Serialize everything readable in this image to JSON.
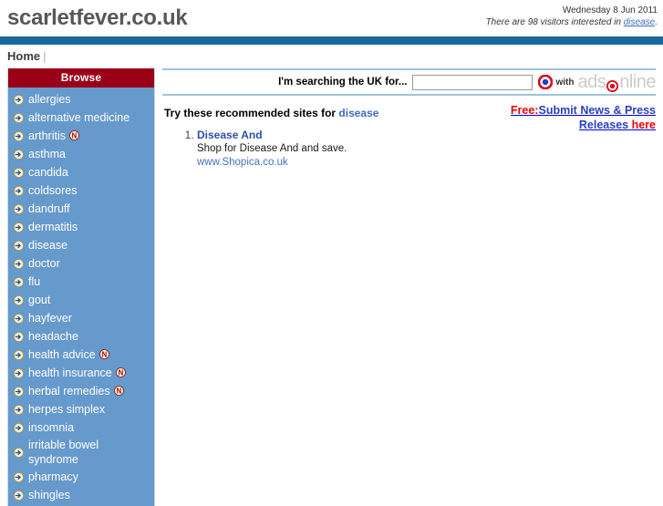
{
  "header": {
    "site_title": "scarletfever.co.uk",
    "date": "Wednesday 8 Jun 2011",
    "visitors_prefix": "There are 98 visitors interested in ",
    "visitors_link": "disease",
    "visitors_suffix": "."
  },
  "nav": {
    "home_label": "Home",
    "separator": "|"
  },
  "sidebar": {
    "title": "Browse",
    "items": [
      {
        "label": "allergies",
        "new": false
      },
      {
        "label": "alternative medicine",
        "new": false
      },
      {
        "label": "arthritis",
        "new": true
      },
      {
        "label": "asthma",
        "new": false
      },
      {
        "label": "candida",
        "new": false
      },
      {
        "label": "coldsores",
        "new": false
      },
      {
        "label": "dandruff",
        "new": false
      },
      {
        "label": "dermatitis",
        "new": false
      },
      {
        "label": "disease",
        "new": false
      },
      {
        "label": "doctor",
        "new": false
      },
      {
        "label": "flu",
        "new": false
      },
      {
        "label": "gout",
        "new": false
      },
      {
        "label": "hayfever",
        "new": false
      },
      {
        "label": "headache",
        "new": false
      },
      {
        "label": "health advice",
        "new": true
      },
      {
        "label": "health insurance",
        "new": true
      },
      {
        "label": "herbal remedies",
        "new": true
      },
      {
        "label": "herpes simplex",
        "new": false
      },
      {
        "label": "insomnia",
        "new": false
      },
      {
        "label": "irritable bowel syndrome",
        "new": false
      },
      {
        "label": "pharmacy",
        "new": false
      },
      {
        "label": "shingles",
        "new": false
      }
    ]
  },
  "search": {
    "label": "I'm searching the UK for...",
    "value": "",
    "placeholder": "",
    "with_text": "with",
    "logo_prefix": "ads",
    "logo_suffix": "nline"
  },
  "promo": {
    "free": "Free:",
    "main": "Submit News & Press Releases ",
    "here": "here"
  },
  "main": {
    "recommend_prefix": "Try these recommended sites for ",
    "recommend_topic": "disease",
    "results": [
      {
        "title": "Disease And",
        "description": "Shop for Disease And and save.",
        "url": "www.Shopica.co.uk"
      }
    ]
  },
  "colors": {
    "blue_bar": "#17699c",
    "browse_header": "#9b0019",
    "sidebar_bg": "#6699cc",
    "link_blue": "#3d6bbf",
    "promo_red": "#ee0000",
    "promo_blue": "#2b3fbf"
  }
}
